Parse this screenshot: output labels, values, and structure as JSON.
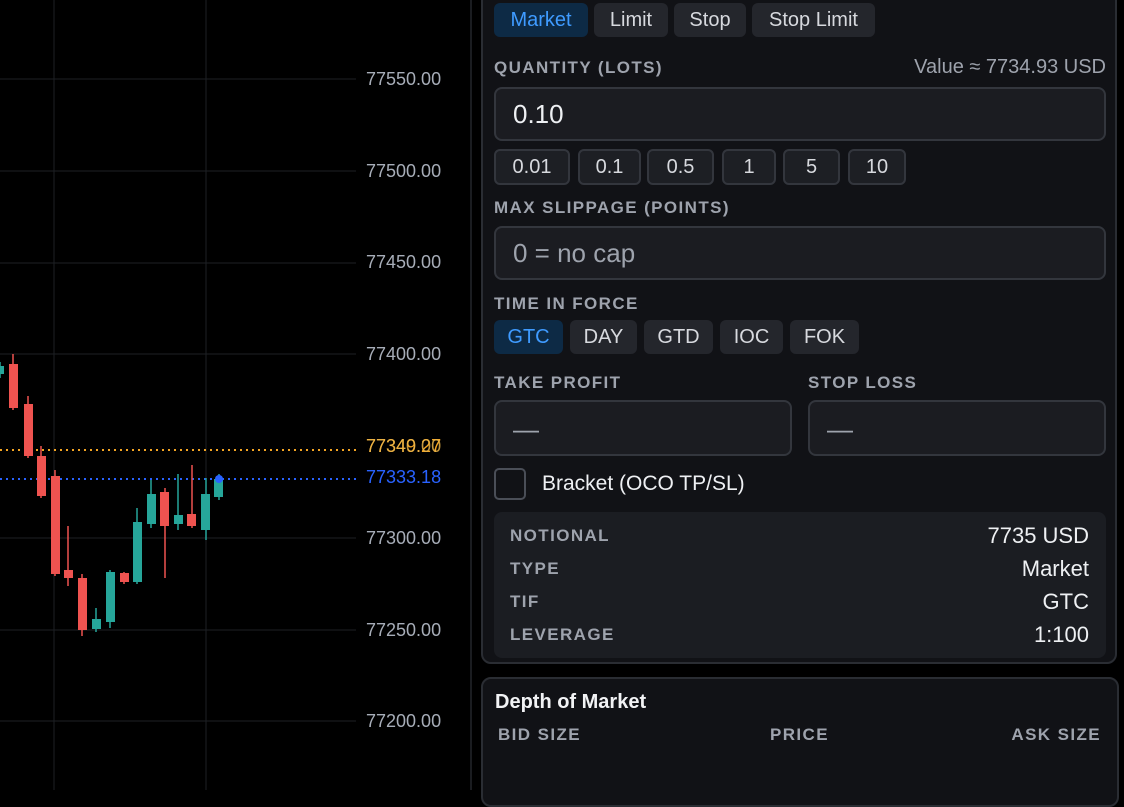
{
  "chart": {
    "price_labels": [
      "77550.00",
      "77500.00",
      "77450.00",
      "77400.00",
      "77300.00",
      "77250.00",
      "77200.00"
    ],
    "overlay_price_a": "77349.27",
    "overlay_price_b": "77340.00",
    "last_price": "77333.18",
    "colors": {
      "up": "#26a69a",
      "down": "#ef5350",
      "last": "#2962ff",
      "bid_ask": "#f5a623",
      "grid": "#1e2024"
    }
  },
  "order_types": [
    "Market",
    "Limit",
    "Stop",
    "Stop Limit"
  ],
  "quantity": {
    "label": "QUANTITY (LOTS)",
    "value_text": "Value ≈ 7734.93 USD",
    "value": "0.10",
    "presets": [
      "0.01",
      "0.1",
      "0.5",
      "1",
      "5",
      "10"
    ]
  },
  "slippage": {
    "label": "MAX SLIPPAGE (POINTS)",
    "placeholder": "0 = no cap"
  },
  "tif": {
    "label": "TIME IN FORCE",
    "options": [
      "GTC",
      "DAY",
      "GTD",
      "IOC",
      "FOK"
    ]
  },
  "take_profit": {
    "label": "TAKE PROFIT",
    "placeholder": "—"
  },
  "stop_loss": {
    "label": "STOP LOSS",
    "placeholder": "—"
  },
  "bracket_label": "Bracket (OCO TP/SL)",
  "summary": {
    "notional_k": "NOTIONAL",
    "notional_v": "7735 USD",
    "type_k": "TYPE",
    "type_v": "Market",
    "tif_k": "TIF",
    "tif_v": "GTC",
    "lev_k": "LEVERAGE",
    "lev_v": "1:100"
  },
  "depth": {
    "title": "Depth of Market",
    "col_bid": "BID SIZE",
    "col_price": "PRICE",
    "col_ask": "ASK SIZE"
  }
}
